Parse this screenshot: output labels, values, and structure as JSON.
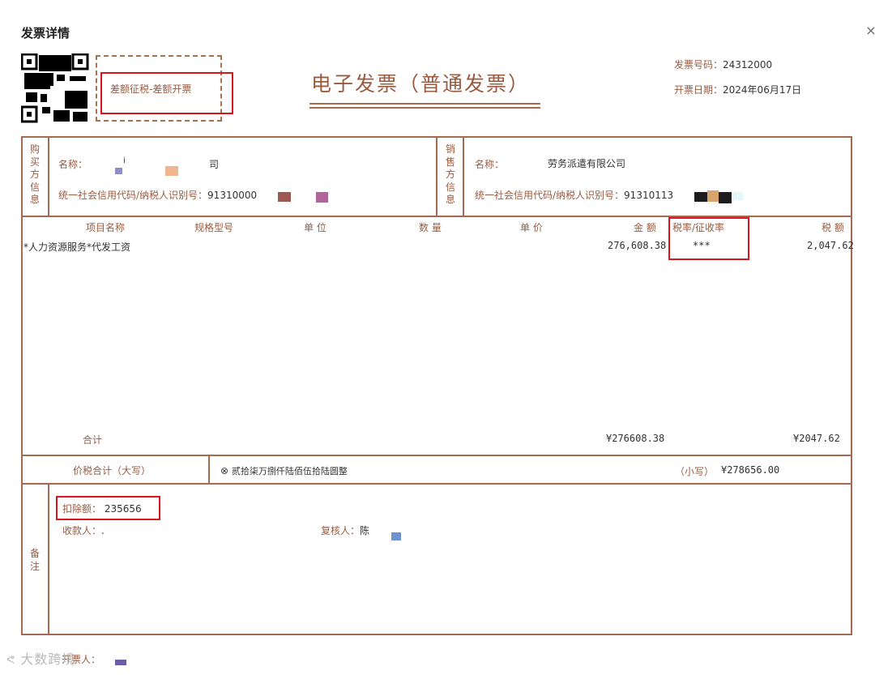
{
  "dialog": {
    "title": "发票详情",
    "close_glyph": "×"
  },
  "invoice": {
    "mark": "差额征税-差额开票",
    "title": "电子发票（普通发票）",
    "number_label": "发票号码：",
    "number": "24312000",
    "date_label": "开票日期：",
    "date": "2024年06月17日"
  },
  "buyer": {
    "side_label": [
      "购",
      "买",
      "方",
      "信",
      "息"
    ],
    "name_label": "名称：",
    "name_value": "司",
    "name_fragment": "i",
    "tax_label": "统一社会信用代码/纳税人识别号：",
    "tax_value": "91310000"
  },
  "seller": {
    "side_label": [
      "销",
      "售",
      "方",
      "信",
      "息"
    ],
    "name_label": "名称：",
    "name_value": "劳务派遣有限公司",
    "tax_label": "统一社会信用代码/纳税人识别号：",
    "tax_value": "91310113"
  },
  "table": {
    "headers": {
      "item": "项目名称",
      "spec": "规格型号",
      "unit": "单 位",
      "qty": "数 量",
      "price": "单 价",
      "amount": "金 额",
      "rate": "税率/征收率",
      "tax": "税 额"
    },
    "rows": [
      {
        "item": "*人力资源服务*代发工资",
        "amount": "276,608.38",
        "rate": "***",
        "tax": "2,047.62"
      }
    ],
    "total_label": "合计",
    "total_amount": "¥276608.38",
    "total_tax": "¥2047.62"
  },
  "grand_total": {
    "label": "价税合计（大写）",
    "icon": "⊗",
    "uppercase": "贰拾柒万捌仟陆佰伍拾陆圆整",
    "small_label": "（小写）",
    "small_value": "¥278656.00"
  },
  "remarks": {
    "side_label": [
      "备",
      "注"
    ],
    "deduction_label": "扣除额：",
    "deduction_value": "235656",
    "payee_label": "收款人：",
    "payee_value": ".",
    "reviewer_label": "复核人：",
    "reviewer_value": "陈"
  },
  "footer": {
    "issuer_fragment": "开票人：",
    "watermark": "大数跨境"
  },
  "colors": {
    "invoice_brown": "#9a5b40",
    "highlight_red": "#d8141c"
  }
}
